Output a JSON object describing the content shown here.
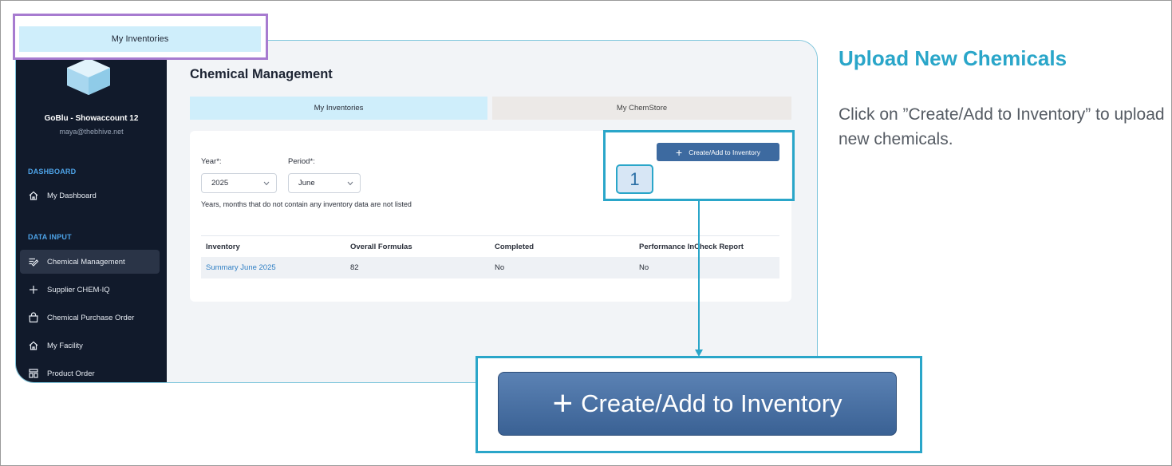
{
  "panel": {
    "title": "Upload New Chemicals",
    "instruction": "Click on ”Create/Add to Inventory” to upload new chemicals."
  },
  "tooltip": {
    "label": "My Inventories"
  },
  "step_badge": "1",
  "sidebar": {
    "account_name": "GoBlu - Showaccount 12",
    "account_email": "maya@thebhive.net",
    "sections": [
      {
        "heading": "DASHBOARD"
      },
      {
        "heading": "DATA INPUT"
      }
    ],
    "items": [
      {
        "label": "My Dashboard",
        "icon": "home-icon"
      },
      {
        "label": "Chemical Management",
        "icon": "edit-list-icon",
        "active": true
      },
      {
        "label": "Supplier CHEM-IQ",
        "icon": "plus-icon"
      },
      {
        "label": "Chemical Purchase Order",
        "icon": "shopping-bag-icon"
      },
      {
        "label": "My Facility",
        "icon": "home-icon"
      },
      {
        "label": "Product Order",
        "icon": "grid-icon"
      }
    ]
  },
  "main": {
    "title": "Chemical Management",
    "tabs": [
      {
        "label": "My Inventories",
        "active": true
      },
      {
        "label": "My ChemStore",
        "active": false
      }
    ],
    "create_button": "Create/Add to Inventory",
    "year_label": "Year*:",
    "year_value": "2025",
    "period_label": "Period*:",
    "period_value": "June",
    "hint": "Years, months that do not contain any inventory data are not listed",
    "table": {
      "headers": [
        "Inventory",
        "Overall Formulas",
        "Completed",
        "Performance InCheck Report"
      ],
      "rows": [
        [
          "Summary June 2025",
          "82",
          "No",
          "No"
        ]
      ]
    }
  },
  "zoom": {
    "button_label": "Create/Add to Inventory"
  },
  "colors": {
    "accent": "#2aa6c9",
    "sidebar_bg": "#111a2b",
    "button": "#3d6aa0",
    "tooltip_border": "#a77bd0"
  }
}
